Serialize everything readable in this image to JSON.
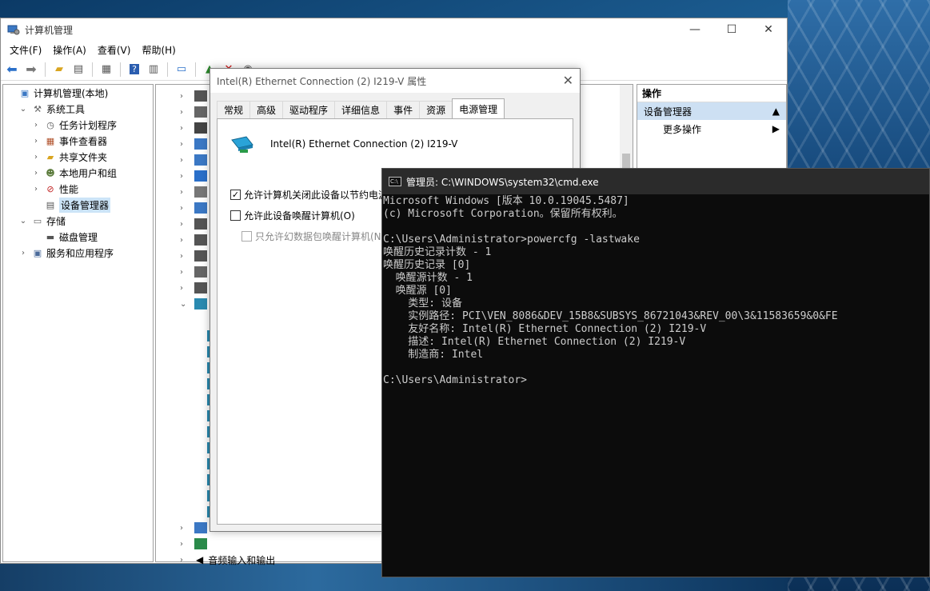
{
  "mmc": {
    "title": "计算机管理",
    "menu": [
      "文件(F)",
      "操作(A)",
      "查看(V)",
      "帮助(H)"
    ],
    "tree": [
      {
        "label": "计算机管理(本地)",
        "arrow": "",
        "indent": 0,
        "icon": "computer-management-icon"
      },
      {
        "label": "系统工具",
        "arrow": "⌄",
        "indent": 1,
        "icon": "tools-icon"
      },
      {
        "label": "任务计划程序",
        "arrow": "›",
        "indent": 2,
        "icon": "clock-icon"
      },
      {
        "label": "事件查看器",
        "arrow": "›",
        "indent": 2,
        "icon": "event-viewer-icon"
      },
      {
        "label": "共享文件夹",
        "arrow": "›",
        "indent": 2,
        "icon": "shared-folder-icon"
      },
      {
        "label": "本地用户和组",
        "arrow": "›",
        "indent": 2,
        "icon": "users-icon"
      },
      {
        "label": "性能",
        "arrow": "›",
        "indent": 2,
        "icon": "performance-icon"
      },
      {
        "label": "设备管理器",
        "arrow": "",
        "indent": 2,
        "icon": "device-manager-icon",
        "selected": true
      },
      {
        "label": "存储",
        "arrow": "⌄",
        "indent": 1,
        "icon": "storage-icon"
      },
      {
        "label": "磁盘管理",
        "arrow": "",
        "indent": 2,
        "icon": "disk-icon"
      },
      {
        "label": "服务和应用程序",
        "arrow": "›",
        "indent": 1,
        "icon": "services-icon"
      }
    ],
    "device_last": "音频输入和输出",
    "actions": {
      "header": "操作",
      "section": "设备管理器",
      "more": "更多操作"
    }
  },
  "dialog": {
    "title": "Intel(R) Ethernet Connection (2) I219-V 属性",
    "tabs": [
      "常规",
      "高级",
      "驱动程序",
      "详细信息",
      "事件",
      "资源",
      "电源管理"
    ],
    "active_tab": "电源管理",
    "device_name": "Intel(R) Ethernet Connection (2) I219-V",
    "opt1": "允许计算机关闭此设备以节约电源",
    "opt2": "允许此设备唤醒计算机(O)",
    "opt3": "只允许幻数据包唤醒计算机(N)",
    "opt1_checked": true,
    "opt2_checked": false,
    "opt3_checked": false
  },
  "cmd": {
    "title": "管理员: C:\\WINDOWS\\system32\\cmd.exe",
    "lines": [
      "Microsoft Windows [版本 10.0.19045.5487]",
      "(c) Microsoft Corporation。保留所有权利。",
      "",
      "C:\\Users\\Administrator>powercfg -lastwake",
      "唤醒历史记录计数 - 1",
      "唤醒历史记录 [0]",
      "  唤醒源计数 - 1",
      "  唤醒源 [0]",
      "    类型: 设备",
      "    实例路径: PCI\\VEN_8086&DEV_15B8&SUBSYS_86721043&REV_00\\3&11583659&0&FE",
      "    友好名称: Intel(R) Ethernet Connection (2) I219-V",
      "    描述: Intel(R) Ethernet Connection (2) I219-V",
      "    制造商: Intel",
      "",
      "C:\\Users\\Administrator>"
    ]
  }
}
